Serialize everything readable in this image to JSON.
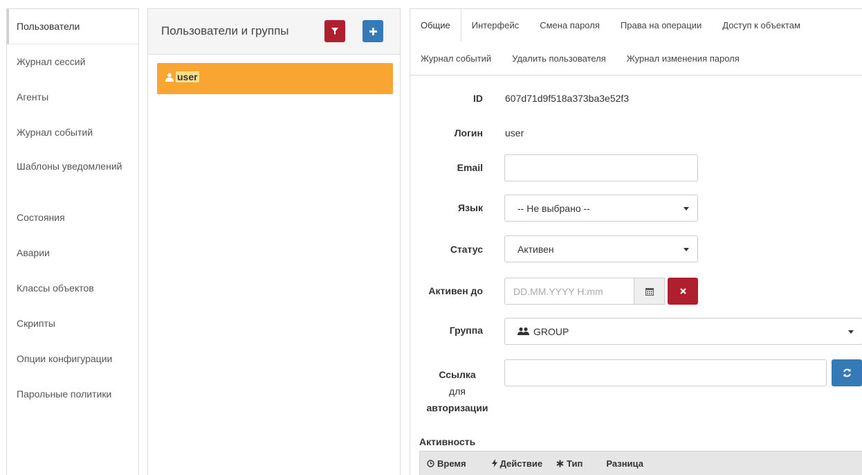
{
  "sidebar": {
    "items": [
      {
        "label": "Пользователи"
      },
      {
        "label": "Журнал сессий"
      },
      {
        "label": "Агенты"
      },
      {
        "label": "Журнал событий"
      },
      {
        "label": "Шаблоны уведомлений"
      },
      {
        "label": "Состояния"
      },
      {
        "label": "Аварии"
      },
      {
        "label": "Классы объектов"
      },
      {
        "label": "Скрипты"
      },
      {
        "label": "Опции конфигурации"
      },
      {
        "label": "Парольные политики"
      }
    ]
  },
  "users_panel": {
    "title": "Пользователи и группы",
    "selected_item": "user"
  },
  "tabs": {
    "row1": [
      "Общие",
      "Интерфейс",
      "Смена пароля",
      "Права на операции",
      "Доступ к объектам"
    ],
    "row2": [
      "Журнал событий",
      "Удалить пользователя",
      "Журнал изменения пароля"
    ]
  },
  "form": {
    "id_label": "ID",
    "id_value": "607d71d9f518a373ba3e52f3",
    "login_label": "Логин",
    "login_value": "user",
    "email_label": "Email",
    "email_value": "",
    "lang_label": "Язык",
    "lang_value": "-- Не выбрано --",
    "status_label": "Статус",
    "status_value": "Активен",
    "active_until_label": "Активен до",
    "active_until_placeholder": "DD.MM.YYYY H:mm",
    "group_label": "Группа",
    "group_value": "GROUP",
    "auth_link_label_1": "Ссылка",
    "auth_link_label_2": "для",
    "auth_link_label_3": "авторизации",
    "auth_link_value": ""
  },
  "activity": {
    "title": "Активность",
    "columns": [
      "Время",
      "Действие",
      "Тип",
      "Разница"
    ]
  },
  "colors": {
    "danger": "#b01f2e",
    "primary": "#337ab7",
    "selected": "#f8a531"
  }
}
